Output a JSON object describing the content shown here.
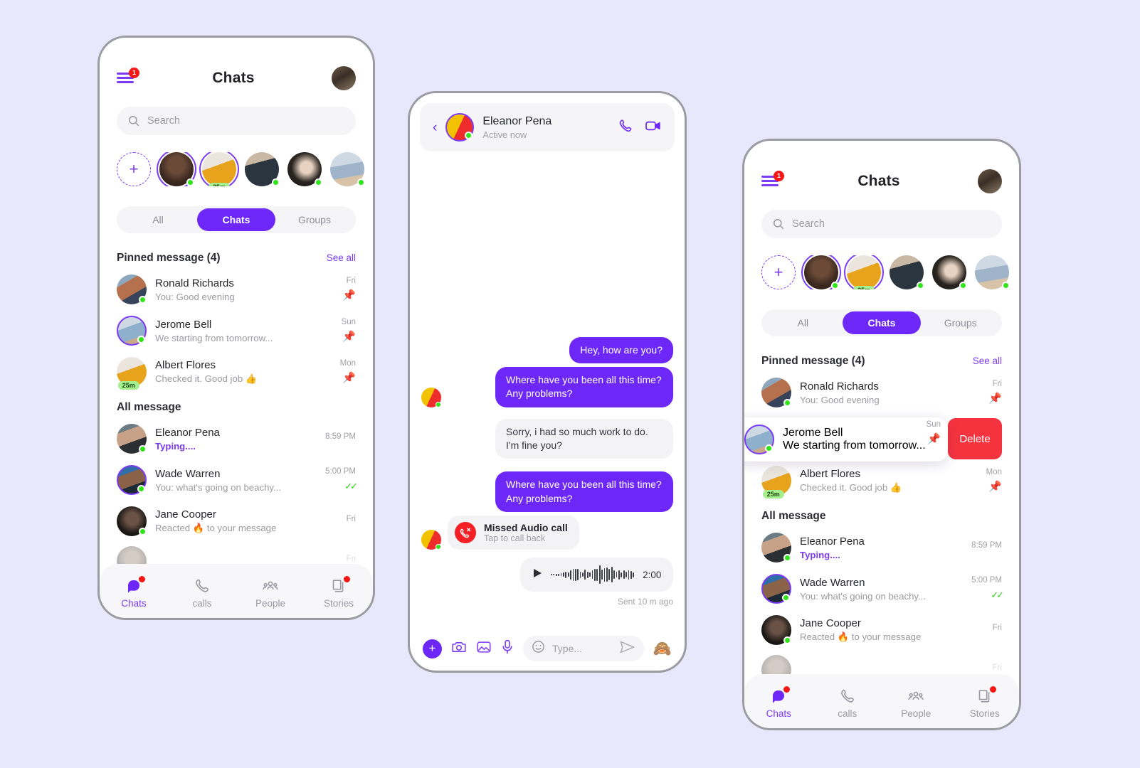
{
  "theme": {
    "accent": "#6d28f8",
    "accent_light": "#7b3bf5",
    "background": "#e8e7fb",
    "online": "#2fe418",
    "danger": "#f5333f",
    "badge_red": "#f51616"
  },
  "chats_screen": {
    "menu_badge": "1",
    "title": "Chats",
    "search_placeholder": "Search",
    "add_story_label": "+",
    "story_time_chip": "25m",
    "tabs": [
      {
        "label": "All",
        "active": false
      },
      {
        "label": "Chats",
        "active": true
      },
      {
        "label": "Groups",
        "active": false
      }
    ],
    "pinned_header": "Pinned message (4)",
    "see_all": "See all",
    "all_message_header": "All message",
    "pinned": [
      {
        "name": "Ronald Richards",
        "preview": "You: Good evening",
        "time": "Fri",
        "pin": true
      },
      {
        "name": "Jerome Bell",
        "preview": "We starting from tomorrow...",
        "time": "Sun",
        "pin": true
      },
      {
        "name": "Albert Flores",
        "preview": "Checked it.  Good job 👍",
        "time": "Mon",
        "pin": true,
        "chip": "25m"
      }
    ],
    "all": [
      {
        "name": "Eleanor Pena",
        "preview": "Typing....",
        "time": "8:59 PM",
        "typing": true
      },
      {
        "name": "Wade Warren",
        "preview": "You: what's going on beachy...",
        "time": "5:00 PM",
        "ticks": "✓✓"
      },
      {
        "name": "Jane Cooper",
        "preview": "Reacted 🔥 to your message",
        "time": "Fri"
      },
      {
        "name": "",
        "preview": "",
        "time": "Fri"
      }
    ],
    "bottom_nav": [
      {
        "label": "Chats",
        "icon": "chat-bubble-icon",
        "active": true,
        "badge": true
      },
      {
        "label": "calls",
        "icon": "phone-icon",
        "active": false,
        "badge": false
      },
      {
        "label": "People",
        "icon": "people-icon",
        "active": false,
        "badge": false
      },
      {
        "label": "Stories",
        "icon": "stories-icon",
        "active": false,
        "badge": true
      }
    ]
  },
  "conversation_screen": {
    "contact_name": "Eleanor Pena",
    "contact_status": "Active now",
    "back_icon": "chevron-left-icon",
    "audio_call_icon": "phone-icon",
    "video_call_icon": "video-camera-icon",
    "messages": [
      {
        "side": "out",
        "text": "Hey, how are you?"
      },
      {
        "side": "out",
        "text": "Where have you been all this time? Any problems?",
        "avatar": true
      },
      {
        "side": "in",
        "text": "Sorry, i had so much work to do. I'm fine you?"
      },
      {
        "side": "out",
        "text": "Where have you been all this time? Any problems?"
      }
    ],
    "missed_call": {
      "title": "Missed Audio call",
      "subtitle": "Tap to call back",
      "icon": "missed-call-icon"
    },
    "voice_note": {
      "duration": "2:00",
      "play_icon": "play-icon"
    },
    "sent_label": "Sent 10 m ago",
    "input": {
      "placeholder": "Type...",
      "plus_label": "+",
      "camera_icon": "camera-icon",
      "gallery_icon": "image-icon",
      "mic_icon": "microphone-icon",
      "emoji_icon": "smiley-icon",
      "send_icon": "send-icon",
      "sticker": "🙈"
    }
  },
  "swipe_screen": {
    "swiped_row": {
      "name": "Jerome Bell",
      "preview": "We starting from tomorrow...",
      "time": "Sun"
    },
    "delete_label": "Delete"
  }
}
